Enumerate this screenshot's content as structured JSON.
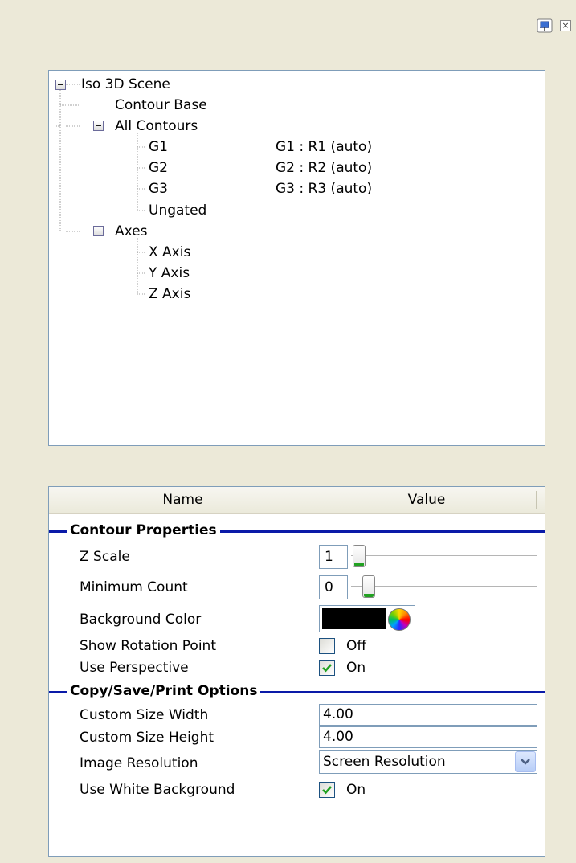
{
  "tree": {
    "nodes": [
      {
        "label": "Iso 3D Scene",
        "value": ""
      },
      {
        "label": "Contour Base",
        "value": ""
      },
      {
        "label": "All Contours",
        "value": ""
      },
      {
        "label": "G1",
        "value": "G1 : R1  (auto)"
      },
      {
        "label": "G2",
        "value": "G2 : R2  (auto)"
      },
      {
        "label": "G3",
        "value": "G3 : R3  (auto)"
      },
      {
        "label": "Ungated",
        "value": ""
      },
      {
        "label": "Axes",
        "value": ""
      },
      {
        "label": "X Axis",
        "value": ""
      },
      {
        "label": "Y Axis",
        "value": ""
      },
      {
        "label": "Z Axis",
        "value": ""
      }
    ]
  },
  "grid": {
    "header_name": "Name",
    "header_value": "Value",
    "categories": [
      {
        "label": "Contour Properties"
      },
      {
        "label": "Copy/Save/Print Options"
      }
    ],
    "props": {
      "z_scale": {
        "label": "Z Scale",
        "value": "1",
        "slider_level": 0.0
      },
      "min_count": {
        "label": "Minimum Count",
        "value": "0",
        "slider_level": 0.0
      },
      "bg_color": {
        "label": "Background Color",
        "color": "#000000"
      },
      "rotation_point": {
        "label": "Show Rotation Point",
        "checked": false,
        "state": "Off"
      },
      "perspective": {
        "label": "Use Perspective",
        "checked": true,
        "state": "On"
      },
      "custom_width": {
        "label": "Custom Size Width",
        "value": "4.00"
      },
      "custom_height": {
        "label": "Custom Size Height",
        "value": "4.00"
      },
      "image_resolution": {
        "label": "Image Resolution",
        "value": "Screen Resolution"
      },
      "white_bg": {
        "label": "Use White Background",
        "checked": true,
        "state": "On"
      }
    }
  },
  "icons": [
    "pin-icon",
    "close-icon",
    "collapse-icon",
    "color-wheel-icon",
    "check-icon",
    "chevron-down-icon"
  ]
}
